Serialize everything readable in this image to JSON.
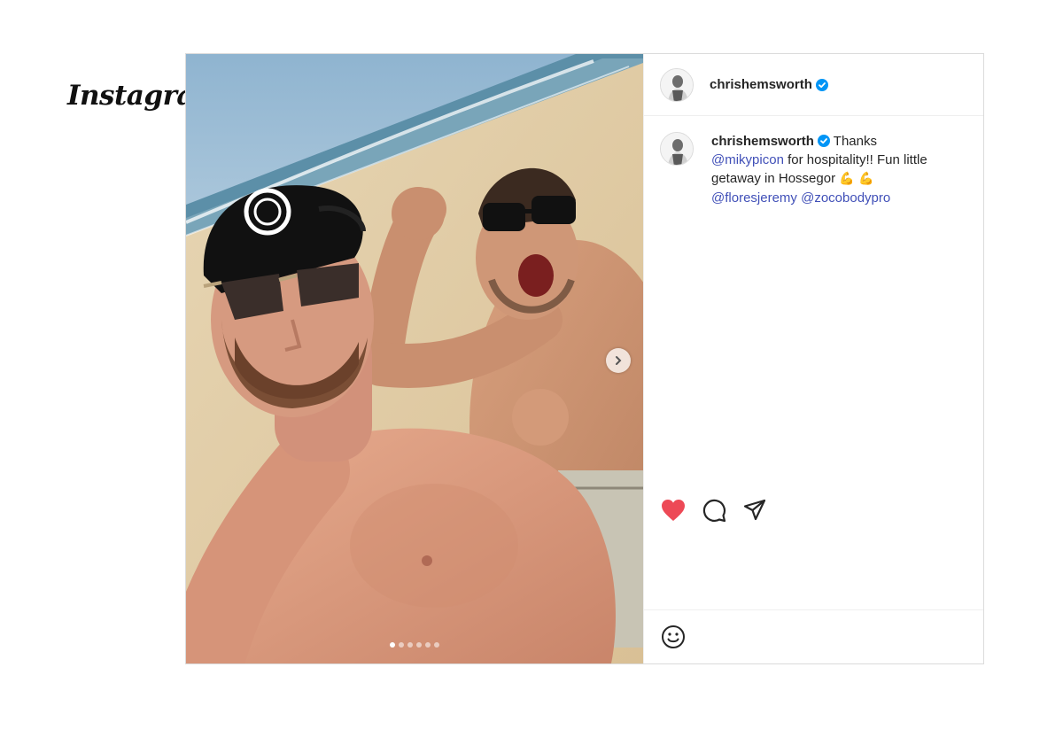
{
  "brand": {
    "logo_text": "Instagram"
  },
  "post": {
    "author": "chrishemsworth",
    "verified": true,
    "media": {
      "description_icon": "photo",
      "carousel_total": 6,
      "carousel_current": 1
    },
    "caption": {
      "author": "chrishemsworth",
      "text_1": "Thanks",
      "mention_1": "@mikypicon",
      "text_2": "for hospitality!! Fun little getaway in Hossegor",
      "emojis": "💪 💪",
      "mention_2": "@floresjeremy",
      "mention_3": "@zocobodypro"
    },
    "actions": {
      "like_icon": "heart-filled-icon",
      "comment_icon": "comment-icon",
      "share_icon": "share-icon",
      "liked": true
    },
    "composer": {
      "emoji_icon": "smiley-icon"
    }
  },
  "colors": {
    "heart": "#ed4956",
    "mention": "#4150b8",
    "verified": "#0095f6"
  }
}
